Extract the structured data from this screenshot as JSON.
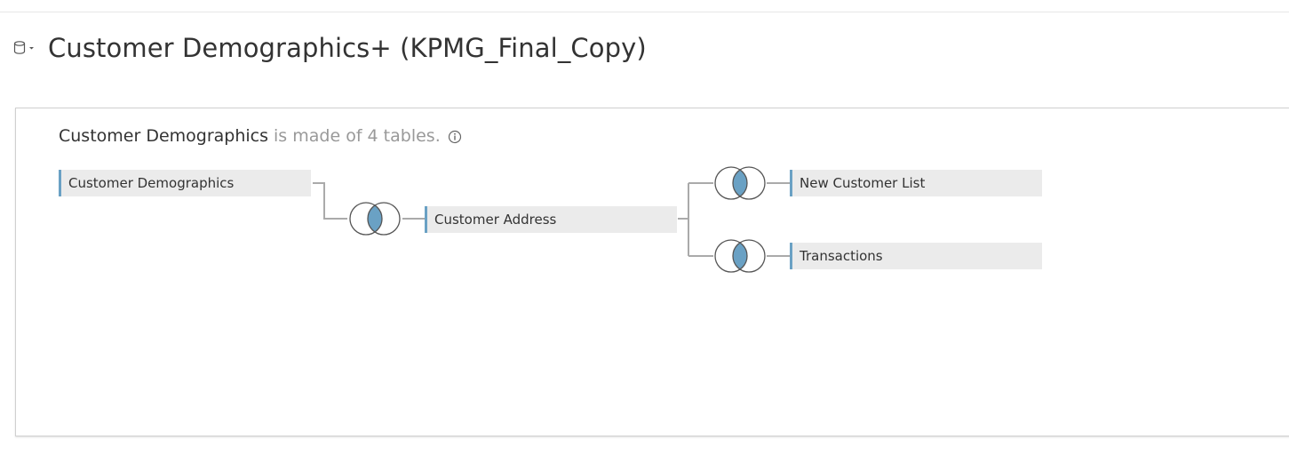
{
  "datasource": {
    "title": "Customer Demographics+ (KPMG_Final_Copy)",
    "menu_icon": "database-dropdown-icon"
  },
  "model": {
    "summary_table": "Customer Demographics",
    "summary_suffix": "is made of 4 tables.",
    "info_icon": "info-icon",
    "tables": [
      {
        "label": "Customer Demographics"
      },
      {
        "label": "Customer Address"
      },
      {
        "label": "New Customer List"
      },
      {
        "label": "Transactions"
      }
    ],
    "joins": [
      {
        "type": "inner",
        "icon": "inner-join-icon"
      },
      {
        "type": "inner",
        "icon": "inner-join-icon"
      },
      {
        "type": "inner",
        "icon": "inner-join-icon"
      }
    ]
  },
  "colors": {
    "accent": "#6aa1c4",
    "join_fill": "#6aa1c4",
    "node_bg": "#ebebeb",
    "connector": "#aaaaaa"
  }
}
